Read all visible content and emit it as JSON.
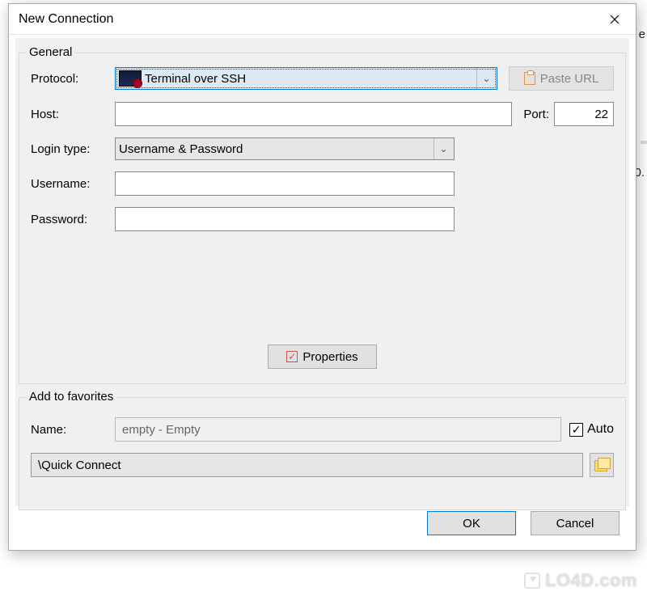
{
  "dialog": {
    "title": "New Connection"
  },
  "general": {
    "legend": "General",
    "protocol_label": "Protocol:",
    "protocol_value": "Terminal over SSH",
    "paste_url": "Paste URL",
    "host_label": "Host:",
    "host_value": "",
    "port_label": "Port:",
    "port_value": "22",
    "login_type_label": "Login type:",
    "login_type_value": "Username & Password",
    "username_label": "Username:",
    "username_value": "",
    "password_label": "Password:",
    "password_value": "",
    "properties_btn": "Properties"
  },
  "favorites": {
    "legend": "Add to favorites",
    "name_label": "Name:",
    "name_value": "empty - Empty",
    "auto_label": "Auto",
    "auto_checked": true,
    "path_value": "\\Quick Connect"
  },
  "buttons": {
    "ok": "OK",
    "cancel": "Cancel"
  },
  "watermark": "LO4D.com"
}
